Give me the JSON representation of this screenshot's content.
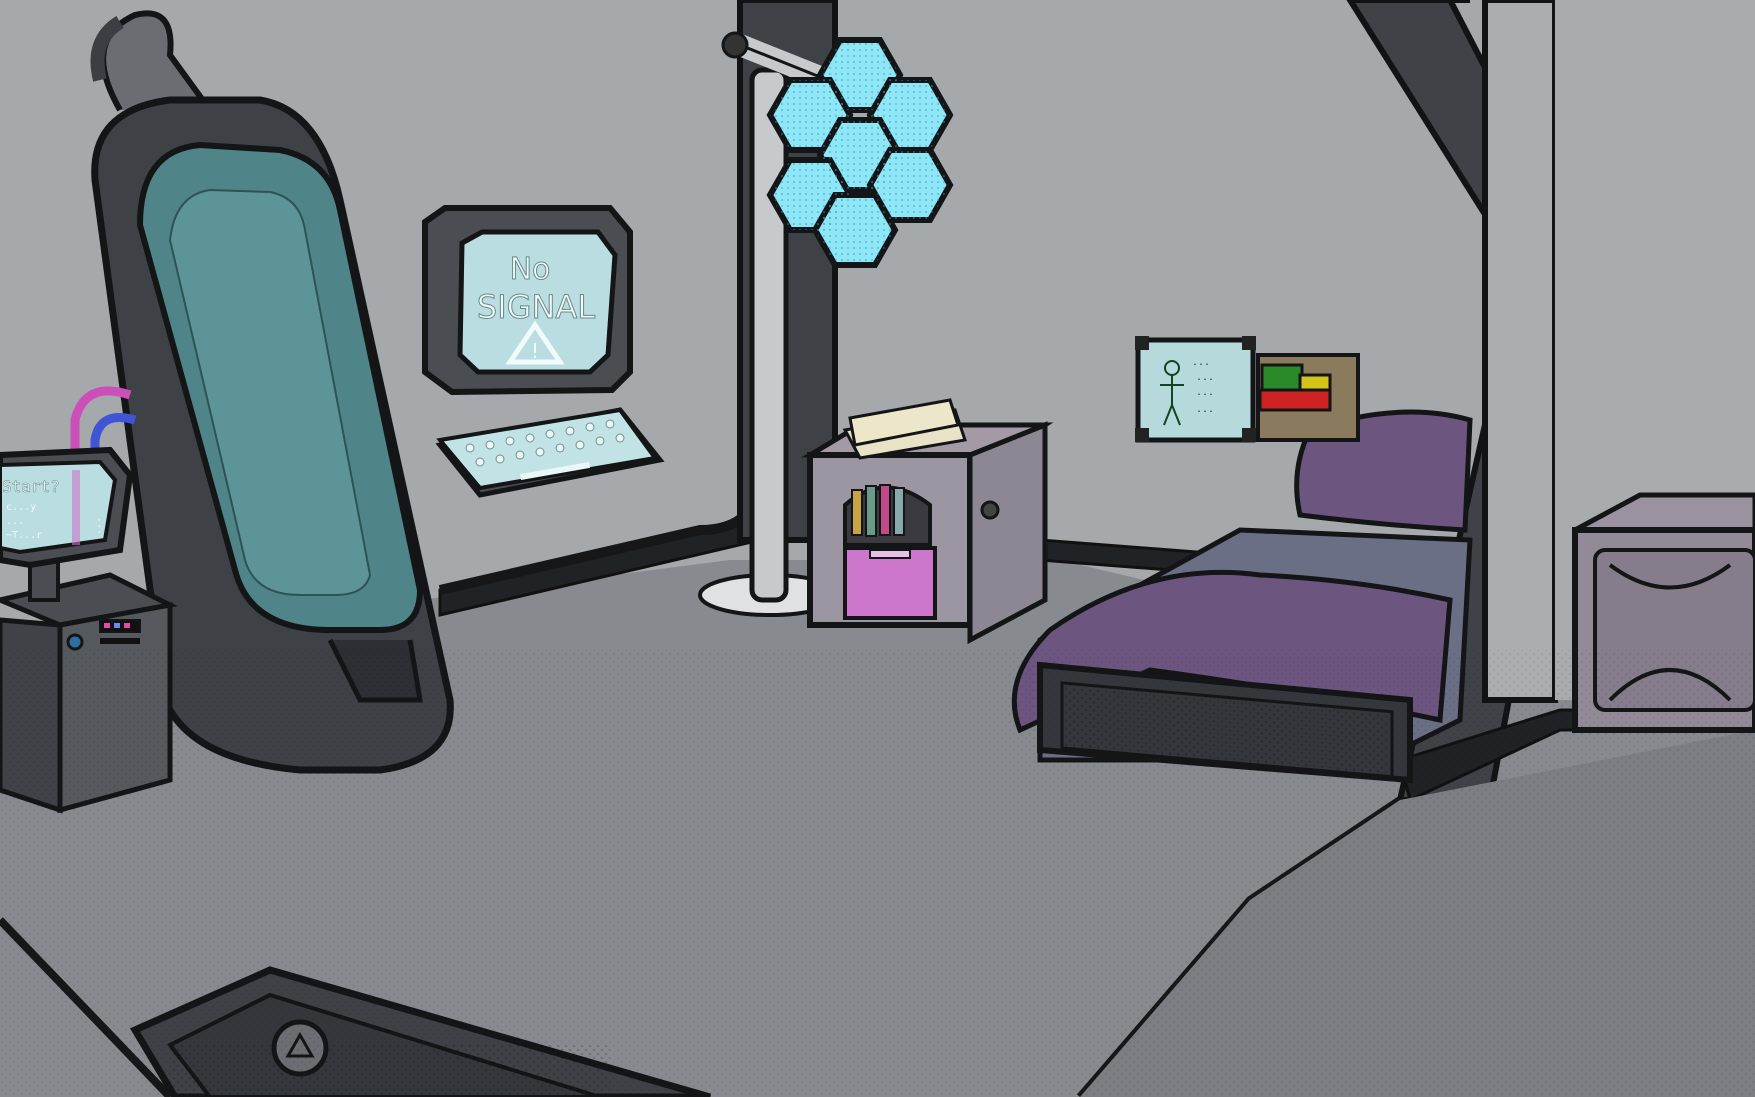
{
  "scene": {
    "main_screen": {
      "line1": "No",
      "line2": "SIGNAL",
      "warning_glyph": "!"
    },
    "side_monitor": {
      "title": "Start?",
      "line1": "c...y",
      "line2": "...",
      "line3": "~T...r",
      "side_text": "..."
    },
    "body_chart": {
      "line1": "...",
      "line2": "...",
      "line3": "...",
      "line4": "..."
    },
    "floor_hatch": {
      "emblem_icon": "triangle-emblem-icon"
    }
  },
  "colors": {
    "wall": "#a7abae",
    "floor": "#8a8e92",
    "floor_near": "#7e8286",
    "frame_dark": "#3f4347",
    "pod_glass": "#4f8488",
    "screen_cyan": "#bfe3e6",
    "lamp_cyan": "#8ee6f7",
    "bed_purple": "#6c5680",
    "drawer_pink": "#cc77cc",
    "cable_pink": "#cc4fb9",
    "cable_blue": "#3f55d6",
    "outline": "#141516"
  }
}
